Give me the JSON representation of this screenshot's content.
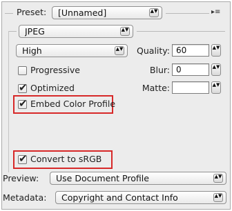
{
  "preset": {
    "label": "Preset:",
    "value": "[Unnamed]",
    "menu_icon": "▸≡"
  },
  "format": {
    "value": "JPEG"
  },
  "quality_preset": {
    "value": "High"
  },
  "quality": {
    "label": "Quality:",
    "value": "60"
  },
  "blur": {
    "label": "Blur:",
    "value": "0"
  },
  "matte": {
    "label": "Matte:",
    "value": ""
  },
  "checkboxes": {
    "progressive": {
      "label": "Progressive",
      "checked": false
    },
    "optimized": {
      "label": "Optimized",
      "checked": true
    },
    "embed_color_profile": {
      "label": "Embed Color Profile",
      "checked": true
    },
    "convert_srgb": {
      "label": "Convert to sRGB",
      "checked": true
    }
  },
  "preview": {
    "label": "Preview:",
    "value": "Use Document Profile"
  },
  "metadata": {
    "label": "Metadata:",
    "value": "Copyright and Contact Info"
  },
  "glyphs": {
    "check": "✔",
    "updown": "▲▼"
  },
  "colors": {
    "highlight": "#d72828",
    "panel_bg": "#ececec"
  }
}
